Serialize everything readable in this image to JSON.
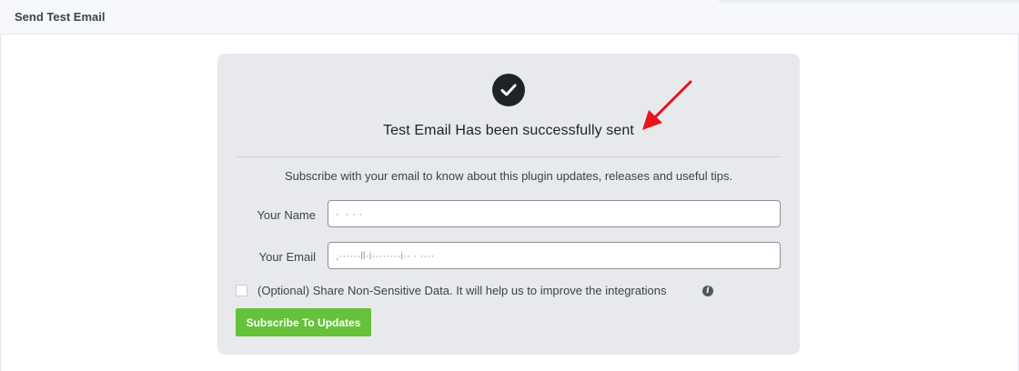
{
  "header": {
    "title": "Send Test Email"
  },
  "card": {
    "status_icon": "check-circle-icon",
    "success_title": "Test Email Has been successfully sent",
    "subscribe_text": "Subscribe with your email to know about this plugin updates, releases and useful tips.",
    "name_field": {
      "label": "Your Name",
      "value": "·  · · ·"
    },
    "email_field": {
      "label": "Your Email",
      "value": ",······ll·i········i·· · ····"
    },
    "optin": {
      "checked": false,
      "label": "(Optional) Share Non-Sensitive Data. It will help us to improve the integrations",
      "info_icon": "info-icon"
    },
    "subscribe_button": "Subscribe To Updates"
  },
  "colors": {
    "accent_green": "#65c23a",
    "card_background": "#e7e9ec",
    "annotation_red": "#e8141b"
  }
}
